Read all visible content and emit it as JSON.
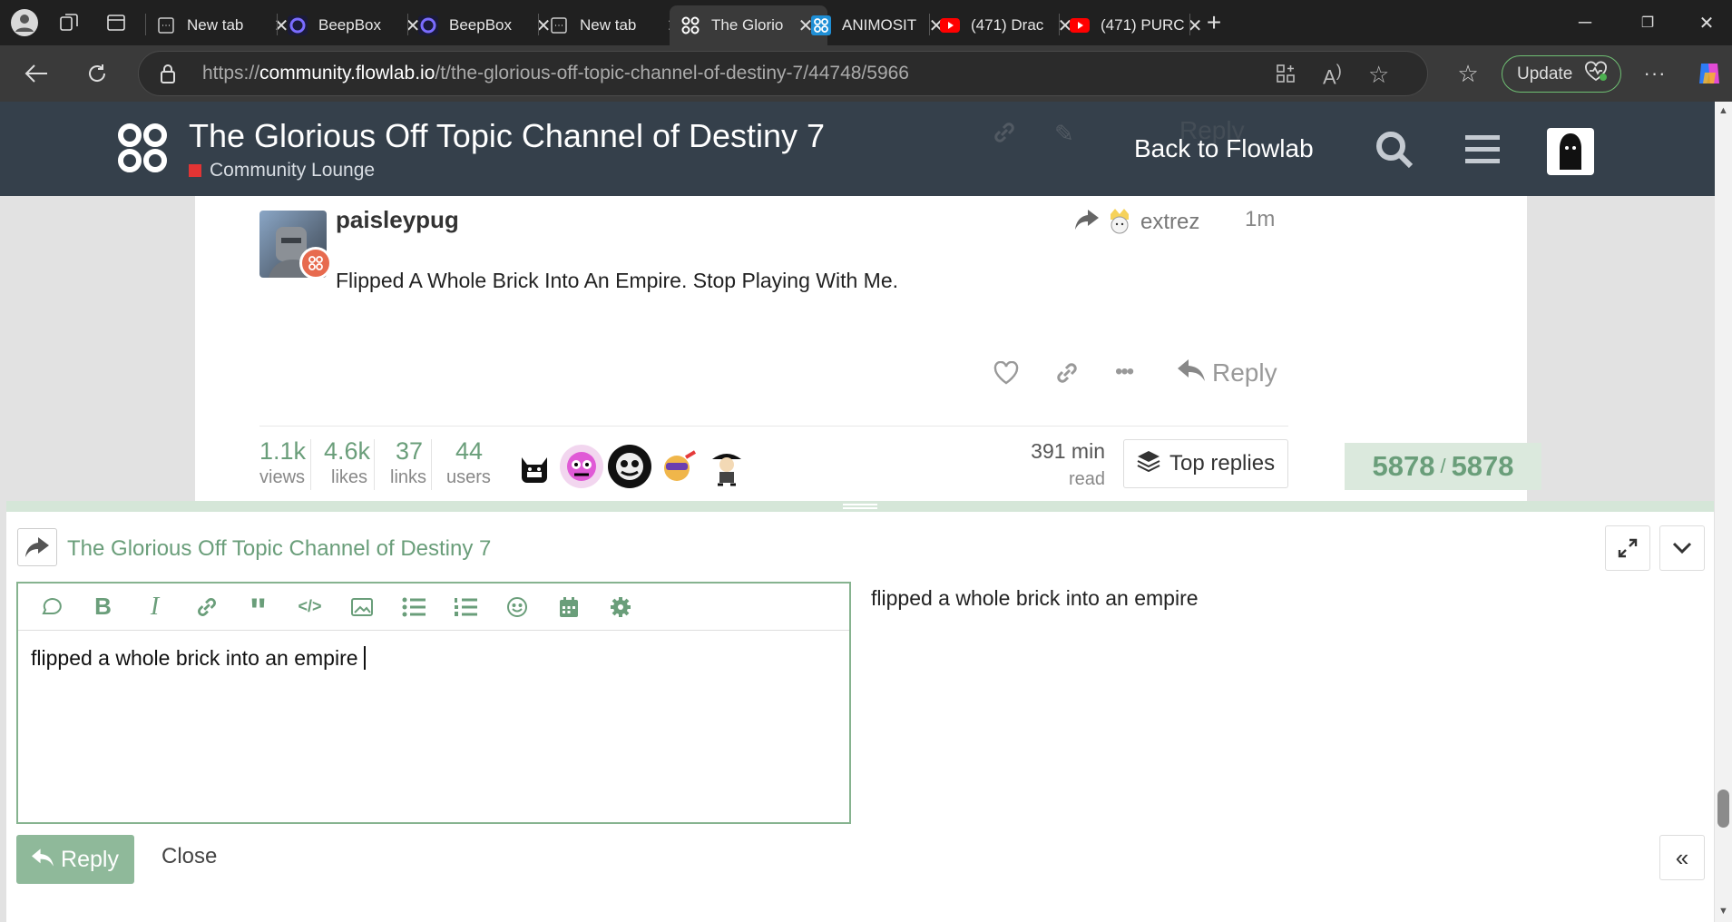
{
  "browser": {
    "tabs": [
      {
        "title": "New tab"
      },
      {
        "title": "BeepBox"
      },
      {
        "title": "BeepBox"
      },
      {
        "title": "New tab"
      },
      {
        "title": "The Glorio"
      },
      {
        "title": "ANIMOSIT"
      },
      {
        "title": "(471) Drac"
      },
      {
        "title": "(471) PURC"
      }
    ],
    "url_prefix": "https://",
    "url_domain": "community.flowlab.io",
    "url_path": "/t/the-glorious-off-topic-channel-of-destiny-7/44748/5966",
    "update_label": "Update"
  },
  "header": {
    "topic_title": "The Glorious Off Topic Channel of Destiny 7",
    "category": "Community Lounge",
    "back_link": "Back to Flowlab",
    "faded_reply": "Reply"
  },
  "post": {
    "username": "paisleypug",
    "reply_to": "extrez",
    "age": "1m",
    "text": "Flipped A Whole Brick Into An Empire. Stop Playing With Me.",
    "reply_label": "Reply"
  },
  "stats": {
    "views": "1.1k",
    "views_label": "views",
    "likes": "4.6k",
    "likes_label": "likes",
    "links": "37",
    "links_label": "links",
    "users": "44",
    "users_label": "users",
    "read_time": "391 min",
    "read_label": "read",
    "top_replies": "Top replies"
  },
  "progress": {
    "current": "5878",
    "separator": "/",
    "total": "5878"
  },
  "composer": {
    "title": "The Glorious Off Topic Channel of Destiny 7",
    "text": "flipped a whole brick into an empire",
    "preview": "flipped a whole brick into an empire",
    "reply_label": "Reply",
    "close_label": "Close"
  },
  "colors": {
    "accent": "#6a9e7a",
    "header": "#35404b",
    "category": "#e23434"
  }
}
